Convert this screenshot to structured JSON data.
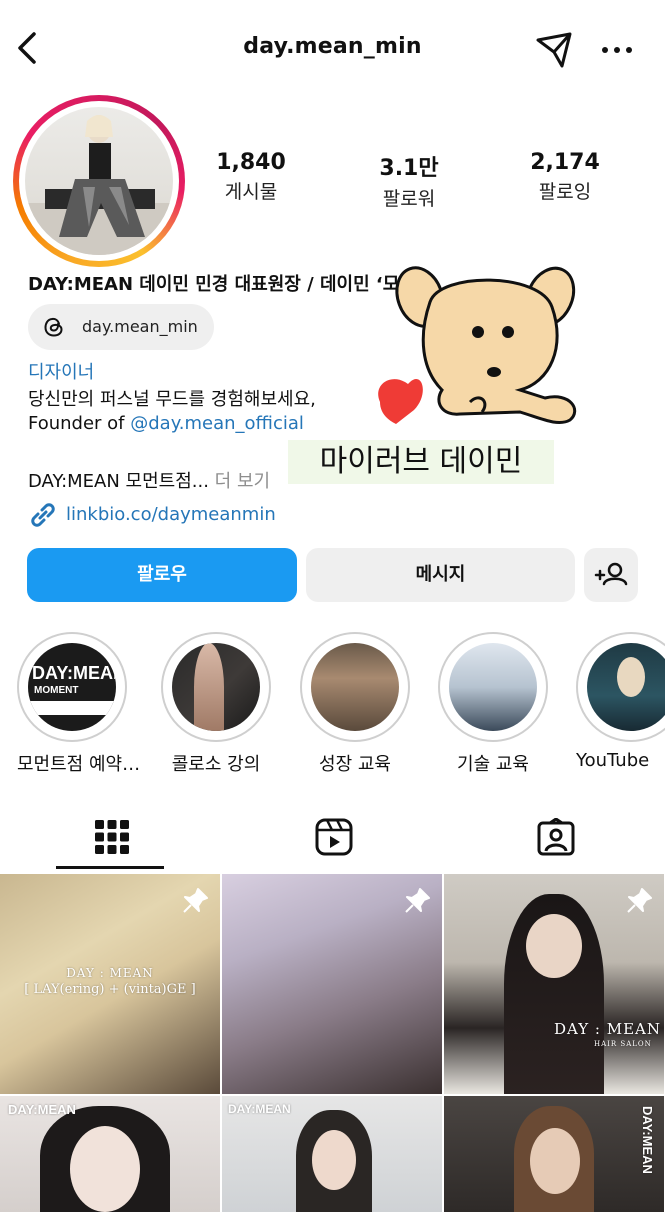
{
  "header": {
    "username": "day.mean_min"
  },
  "stats": [
    {
      "value": "1,840",
      "label": "게시물"
    },
    {
      "value": "3.1만",
      "label": "팔로워"
    },
    {
      "value": "2,174",
      "label": "팔로잉"
    }
  ],
  "bio": {
    "name_line": "DAY:MEAN 데이민 민경 대표원장 / 데이민 ‘모먼",
    "threads_handle": "day.mean_min",
    "category": "디자이너",
    "line1": "당신만의 퍼스널 무드를 경험해보세요,",
    "line2_prefix": "Founder of ",
    "line2_mention": "@day.mean_official",
    "line3": "DAY:MEAN 모먼트점...",
    "line3_more": " 더 보기",
    "link": "linkbio.co/daymeanmin"
  },
  "sticker": {
    "text": "마이러브 데이민"
  },
  "actions": {
    "follow": "팔로우",
    "message": "메시지"
  },
  "highlights": [
    {
      "caption": "모먼트점 예약…",
      "cover_text": "DAY:MEAN",
      "cover_sub": "MOMENT"
    },
    {
      "caption": "콜로소 강의"
    },
    {
      "caption": "성장 교육"
    },
    {
      "caption": "기술 교육"
    },
    {
      "caption": "YouTube"
    }
  ],
  "grid": {
    "posts": [
      {
        "overlay_title": "DAY : MEAN",
        "overlay_sub": "[ LAY(ering) + (vinta)GE ]",
        "pinned": true
      },
      {
        "overlay_title": "",
        "pinned": true
      },
      {
        "overlay_title": "DAY : MEAN",
        "overlay_sub": "HAIR SALON",
        "pinned": true
      },
      {
        "overlay_title": "DAY:MEAN"
      },
      {
        "overlay_title": "DAY:MEAN"
      },
      {
        "overlay_title": "DAY:MEAN"
      }
    ]
  },
  "colors": {
    "follow_button": "#1a9af2",
    "link_blue": "#2576b8",
    "chip_bg": "#efefef"
  }
}
